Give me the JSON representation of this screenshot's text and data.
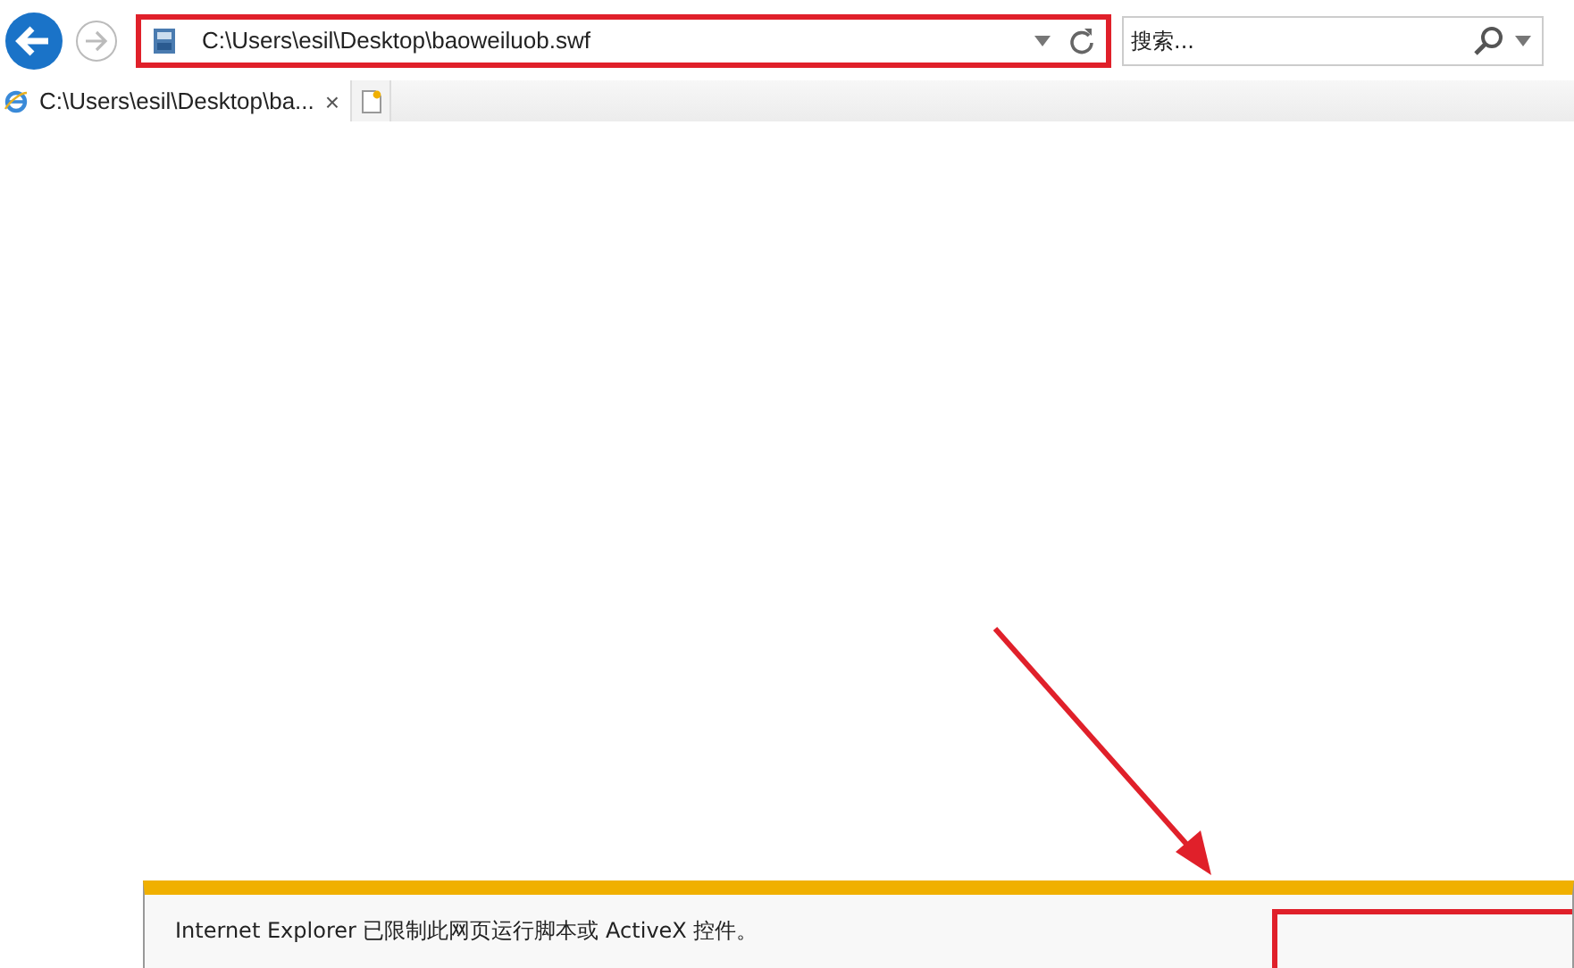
{
  "address_bar": {
    "value": "C:\\Users\\esil\\Desktop\\baoweiluob.swf",
    "highlighted": true
  },
  "search": {
    "placeholder": "搜索..."
  },
  "tabs": [
    {
      "title": "C:\\Users\\esil\\Desktop\\ba...",
      "close": "×",
      "selected": true
    }
  ],
  "notification_bar": {
    "message": "Internet Explorer 已限制此网页运行脚本或 ActiveX 控件。",
    "highlighted": true
  }
}
